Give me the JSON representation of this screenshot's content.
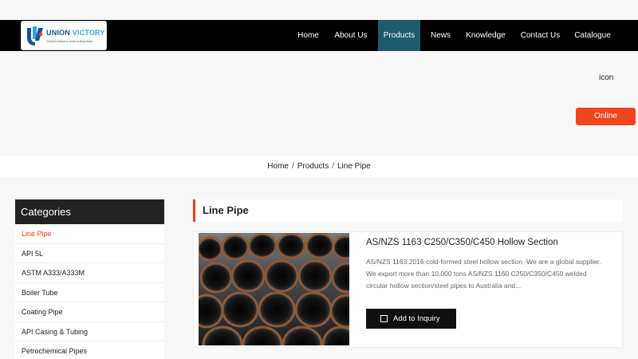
{
  "brand": {
    "name_part1": "UNION",
    "name_part2": "VICTORY",
    "tagline": "China's famous steel enterprises",
    "colors": {
      "primary": "#1a4e9e",
      "accent": "#2ea7e0"
    }
  },
  "nav": {
    "items": [
      {
        "label": "Home",
        "active": false
      },
      {
        "label": "About Us",
        "active": false
      },
      {
        "label": "Products",
        "active": true
      },
      {
        "label": "News",
        "active": false
      },
      {
        "label": "Knowledge",
        "active": false
      },
      {
        "label": "Contact Us",
        "active": false
      },
      {
        "label": "Catalogue",
        "active": false
      }
    ],
    "active_color": "#1d5b6b"
  },
  "hero": {
    "icon_text": "icon",
    "online_label": "Online",
    "online_color": "#f0451e"
  },
  "breadcrumb": [
    "Home",
    "Products",
    "Line Pipe"
  ],
  "sidebar": {
    "title": "Categories",
    "items": [
      {
        "label": "Line Pipe",
        "active": true
      },
      {
        "label": "API 5L",
        "active": false
      },
      {
        "label": "ASTM A333/A333M",
        "active": false
      },
      {
        "label": "Boiler Tube",
        "active": false
      },
      {
        "label": "Coating Pipe",
        "active": false
      },
      {
        "label": "API Casing & Tubing",
        "active": false
      },
      {
        "label": "Petrochemical Pipes",
        "active": false
      }
    ],
    "accent_color": "#e8431a"
  },
  "main": {
    "section_title": "Line Pipe",
    "product": {
      "title": "AS/NZS 1163 C250/C350/C450 Hollow Section",
      "description": "AS/NZS 1163:2016 cold-formed steel hollow section -We are a global supplier. We export more than 10,000 tons AS/NZS 1160 C250/C350/C450 welded circular hollow section/steel pipes to Australia and...",
      "inquiry_label": "Add to Inquiry",
      "image_subject": "stacked steel pipe ends"
    }
  }
}
